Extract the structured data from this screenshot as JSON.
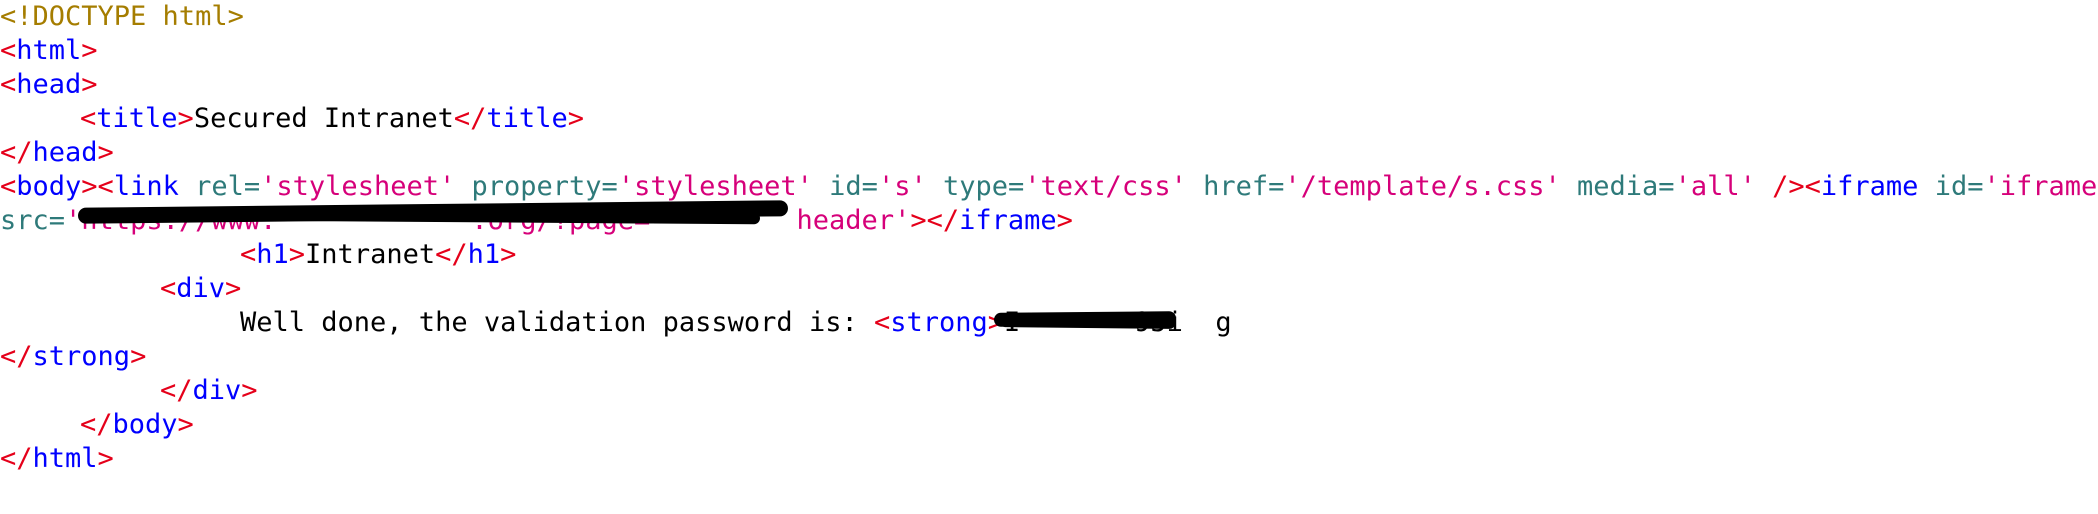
{
  "code": {
    "doctype": "<!DOCTYPE html>",
    "html_open": "html",
    "head_open": "head",
    "title_tag": "title",
    "title_text": "Secured Intranet",
    "head_close": "head",
    "body_tag": "body",
    "link_tag": "link",
    "attr_rel": "rel",
    "val_rel": "'stylesheet'",
    "attr_property": "property",
    "val_property": "'stylesheet'",
    "attr_id": "id",
    "val_id": "'s'",
    "attr_type": "type",
    "val_type": "'text/css'",
    "attr_href": "href",
    "val_href": "'/template/s.css'",
    "attr_media": "media",
    "val_media": "'all'",
    "iframe_tag": "iframe",
    "attr_iframe_id": "id",
    "val_iframe_id": "'iframe'",
    "attr_src": "src",
    "val_src": "'https://www.            .org/?page=         header'",
    "h1_tag": "h1",
    "h1_text": "Intranet",
    "div_tag": "div",
    "message_text": "Well done, the validation password is: ",
    "strong_tag": "strong",
    "password_text": "I       95i  g",
    "html_close": "html"
  },
  "colors": {
    "bracket": "#e5001a",
    "tag": "#0000ff",
    "attribute": "#2e7a7a",
    "value": "#d6007a",
    "doctype": "#a57d00",
    "text": "#000000",
    "redaction": "#000000"
  }
}
